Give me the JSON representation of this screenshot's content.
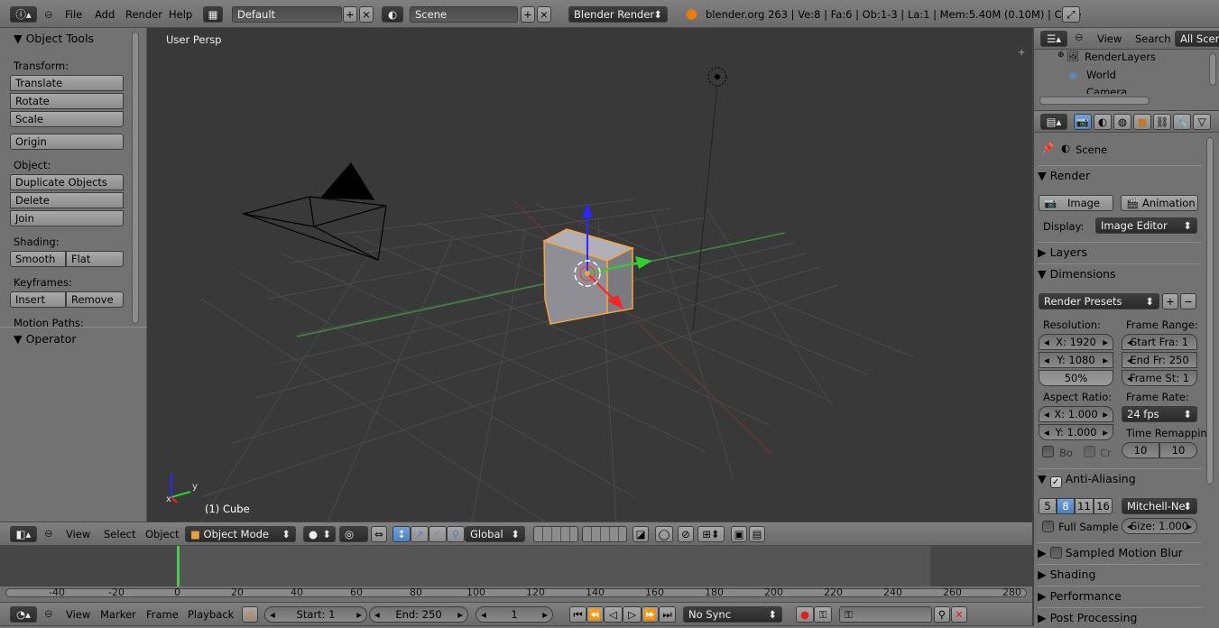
{
  "top_bar": {
    "menus": [
      "File",
      "Add",
      "Render",
      "Help"
    ],
    "screen_layout": "Default",
    "scene": "Scene",
    "engine": "Blender Render",
    "info": "blender.org 263 | Ve:8 | Fa:6 | Ob:1-3 | La:1 | Mem:5.40M (0.10M) | Cube"
  },
  "toolshelf": {
    "title": "Object Tools",
    "transform_label": "Transform:",
    "translate": "Translate",
    "rotate": "Rotate",
    "scale": "Scale",
    "origin": "Origin",
    "object_label": "Object:",
    "duplicate": "Duplicate Objects",
    "delete": "Delete",
    "join": "Join",
    "shading_label": "Shading:",
    "smooth": "Smooth",
    "flat": "Flat",
    "keyframes_label": "Keyframes:",
    "insert": "Insert",
    "remove": "Remove",
    "motion_paths_label": "Motion Paths:",
    "operator": "Operator"
  },
  "viewport": {
    "view_name": "User Persp",
    "object_name": "(1) Cube",
    "axis_y": "y",
    "axis_x": "x"
  },
  "view3d_header": {
    "menus": [
      "View",
      "Select",
      "Object"
    ],
    "mode": "Object Mode",
    "orientation": "Global"
  },
  "timeline": {
    "ticks": [
      "-40",
      "-20",
      "0",
      "20",
      "40",
      "60",
      "80",
      "100",
      "120",
      "140",
      "160",
      "180",
      "200",
      "220",
      "240",
      "260",
      "280"
    ],
    "menus": [
      "View",
      "Marker",
      "Frame",
      "Playback"
    ],
    "start": "Start: 1",
    "end": "End: 250",
    "current": "1",
    "sync": "No Sync"
  },
  "outliner": {
    "menus": [
      "View",
      "Search"
    ],
    "filter": "All Scenes",
    "items": [
      "RenderLayers",
      "World",
      "Camera"
    ]
  },
  "properties": {
    "context": "Scene",
    "render_panel": "Render",
    "image_button": "Image",
    "animation_button": "Animation",
    "display_label": "Display:",
    "display_value": "Image Editor",
    "layers": "Layers",
    "dimensions": "Dimensions",
    "render_presets": "Render Presets",
    "resolution_label": "Resolution:",
    "res_x": "X: 1920",
    "res_y": "Y: 1080",
    "res_pct": "50%",
    "frame_range_label": "Frame Range:",
    "start_frame": "Start Fra: 1",
    "end_frame": "End Fr: 250",
    "frame_step": "Frame St: 1",
    "aspect_label": "Aspect Ratio:",
    "aspect_x": "X: 1.000",
    "aspect_y": "Y: 1.000",
    "frame_rate_label": "Frame Rate:",
    "frame_rate": "24 fps",
    "time_remap_label": "Time Remappin",
    "remap_old": "10",
    "remap_new": "10",
    "border": "Bo",
    "crop": "Cr",
    "anti_aliasing": "Anti-Aliasing",
    "aa_samples": [
      "5",
      "8",
      "11",
      "16"
    ],
    "aa_selected": "8",
    "filter": "Mitchell-Ne",
    "full_sample": "Full Sample",
    "size": "Size: 1.000",
    "motion_blur": "Sampled Motion Blur",
    "shading": "Shading",
    "performance": "Performance",
    "post_processing": "Post Processing"
  },
  "colors": {
    "viewport_bg": "#393939",
    "panel_bg": "#727272",
    "selection": "#f5a442",
    "x_axis": "#ff2020",
    "y_axis": "#2fd12f",
    "z_axis": "#2828ff",
    "current_frame": "#4cc84c"
  }
}
